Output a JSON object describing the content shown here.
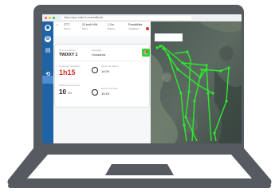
{
  "browser": {
    "url": "https://app.wake-it.com/sailboat"
  },
  "sidebar": {
    "items": [
      {
        "icon": "logo-icon"
      },
      {
        "icon": "gear-icon"
      },
      {
        "icon": "book-icon"
      },
      {
        "icon": "history-icon"
      }
    ]
  },
  "status": {
    "items": [
      {
        "label": "27°C",
        "sub": "Sunny"
      },
      {
        "label": "20 km/h NW",
        "sub": "Wind"
      },
      {
        "label": "1.2m",
        "sub": "Waves"
      },
      {
        "label": "Possibilités",
        "sub": "navigation"
      }
    ]
  },
  "card": {
    "boat_label": "Nom du bateau",
    "boat_name": "TWIXXY 1",
    "crew_label": "Équipage",
    "crew_value": "Oussama",
    "duration_label": "Durée de navigation",
    "duration_value": "1h15",
    "start_label": "Heure de départ",
    "start_value": "14:00",
    "distance_label": "Distance parcourue",
    "distance_value": "10",
    "distance_unit": "nm",
    "end_label": "Heure d'arrivée",
    "end_value": "15:15"
  },
  "colors": {
    "sidebar": "#1f63a7",
    "accent_green": "#2ed03a",
    "duration_red": "#d7332b",
    "track_green": "#2bee2b",
    "laptop_frame": "#555b60"
  }
}
